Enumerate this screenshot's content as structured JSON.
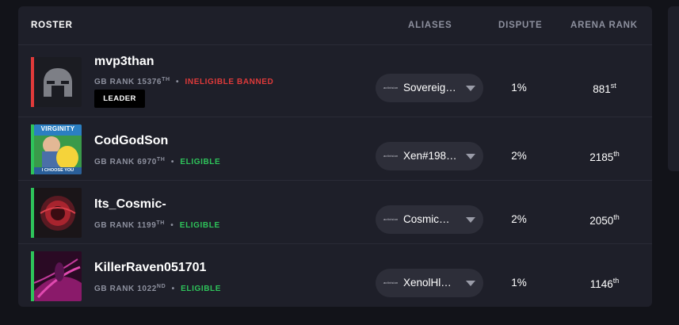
{
  "header": {
    "title": "ROSTER",
    "aliases": "ALIASES",
    "dispute": "DISPUTE",
    "arena_rank": "ARENA RANK"
  },
  "colors": {
    "eligible": "#2ec35a",
    "ineligible": "#e03a3a",
    "panel": "#1e1f29",
    "background": "#121319"
  },
  "alias_logo_text": "activision",
  "players": [
    {
      "name": "mvp3than",
      "gb_rank_label": "GB RANK",
      "gb_rank": "15376",
      "gb_rank_suffix": "TH",
      "status": "INELIGIBLE BANNED",
      "badge": "LEADER",
      "alias": "Sovereig…",
      "dispute": "1%",
      "arena_rank": "881",
      "arena_rank_suffix": "st",
      "avatar_icon": "spartan-helmet-icon"
    },
    {
      "name": "CodGodSon",
      "gb_rank_label": "GB RANK",
      "gb_rank": "6970",
      "gb_rank_suffix": "TH",
      "status": "ELIGIBLE",
      "alias": "Xen#198…",
      "dispute": "2%",
      "arena_rank": "2185",
      "arena_rank_suffix": "th",
      "avatar_top_text": "VIRGINITY",
      "avatar_bottom_text": "I CHOOSE YOU"
    },
    {
      "name": "Its_Cosmic-",
      "gb_rank_label": "GB RANK",
      "gb_rank": "1199",
      "gb_rank_suffix": "TH",
      "status": "ELIGIBLE",
      "alias": "Cosmic…",
      "dispute": "2%",
      "arena_rank": "2050",
      "arena_rank_suffix": "th"
    },
    {
      "name": "KillerRaven051701",
      "gb_rank_label": "GB RANK",
      "gb_rank": "1022",
      "gb_rank_suffix": "ND",
      "status": "ELIGIBLE",
      "alias": "XenolHl…",
      "dispute": "1%",
      "arena_rank": "1146",
      "arena_rank_suffix": "th"
    }
  ]
}
